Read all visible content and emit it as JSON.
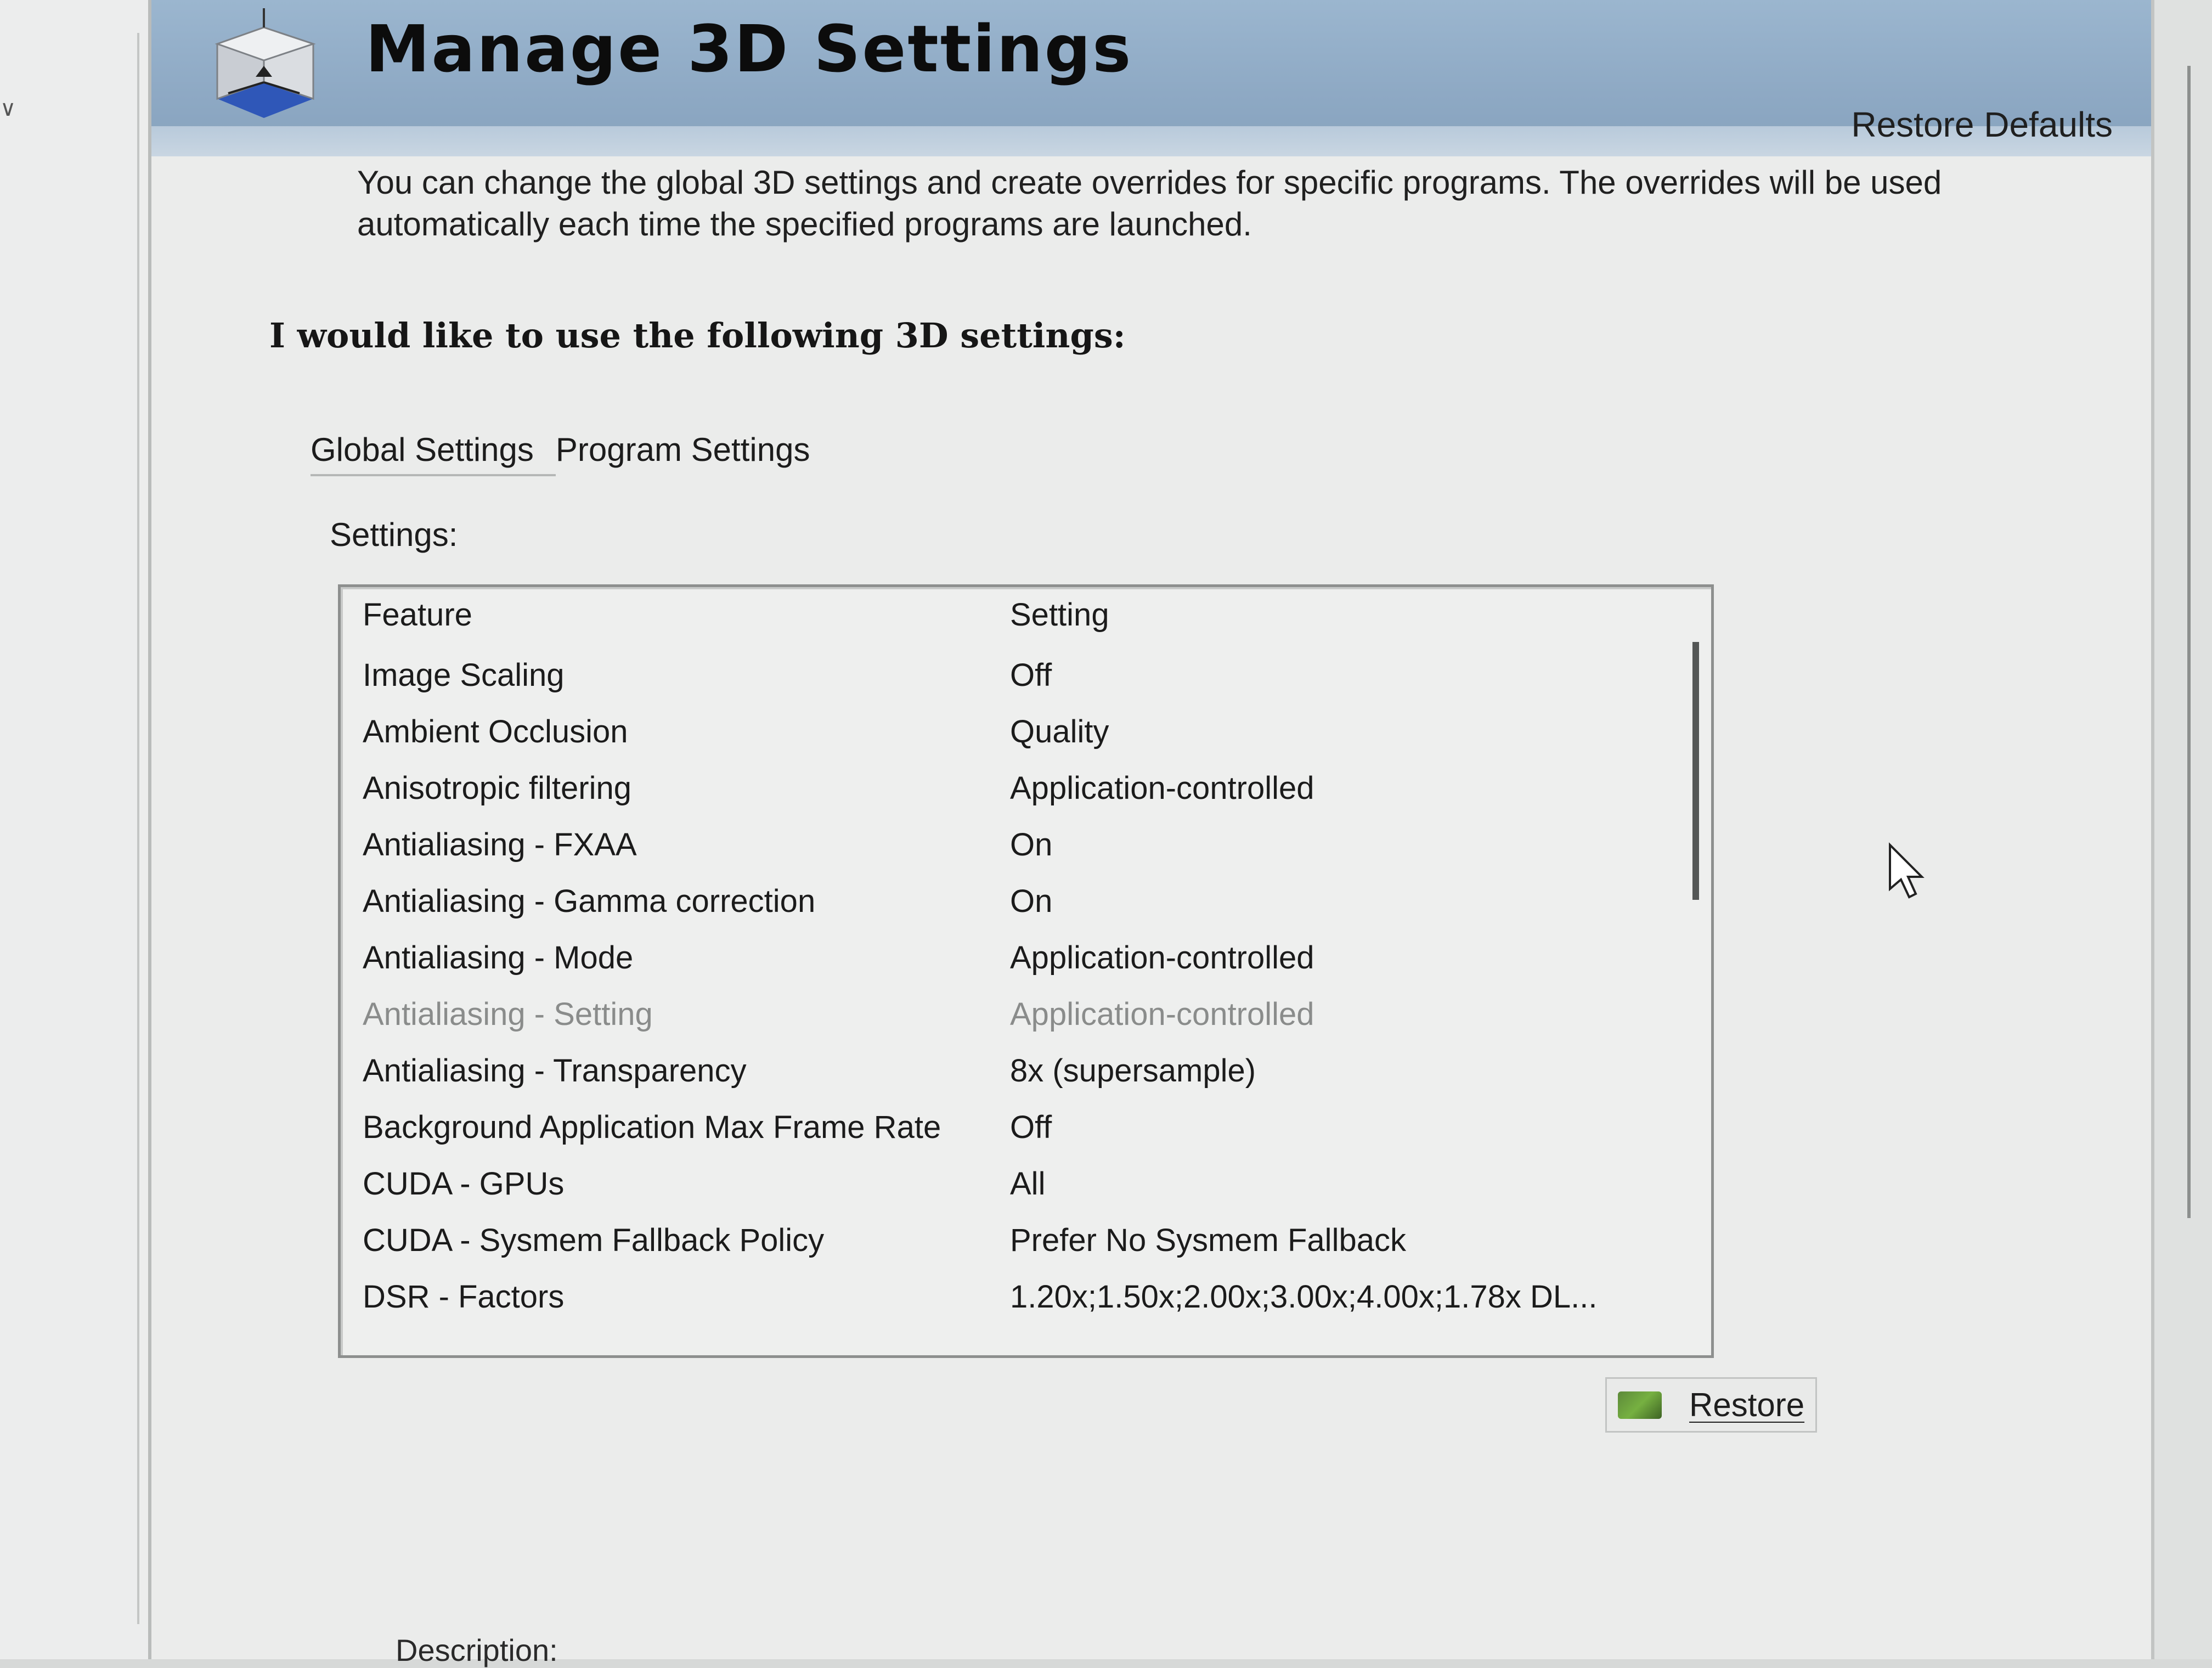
{
  "header": {
    "title": "Manage 3D Settings",
    "restore_defaults": "Restore Defaults"
  },
  "intro_text": "You can change the global 3D settings and create overrides for specific programs. The overrides will be used automatically each time the specified programs are launched.",
  "prompt": "I would like to use the following 3D settings:",
  "tabs": [
    {
      "label": "Global Settings",
      "active": true
    },
    {
      "label": "Program Settings",
      "active": false
    }
  ],
  "settings_label": "Settings:",
  "table": {
    "columns": [
      "Feature",
      "Setting"
    ],
    "rows": [
      {
        "feature": "Image Scaling",
        "setting": "Off"
      },
      {
        "feature": "Ambient Occlusion",
        "setting": "Quality"
      },
      {
        "feature": "Anisotropic filtering",
        "setting": "Application-controlled"
      },
      {
        "feature": "Antialiasing - FXAA",
        "setting": "On"
      },
      {
        "feature": "Antialiasing - Gamma correction",
        "setting": "On"
      },
      {
        "feature": "Antialiasing - Mode",
        "setting": "Application-controlled"
      },
      {
        "feature": "Antialiasing - Setting",
        "setting": "Application-controlled",
        "disabled": true
      },
      {
        "feature": "Antialiasing - Transparency",
        "setting": "8x (supersample)"
      },
      {
        "feature": "Background Application Max Frame Rate",
        "setting": "Off"
      },
      {
        "feature": "CUDA - GPUs",
        "setting": "All"
      },
      {
        "feature": "CUDA - Sysmem Fallback Policy",
        "setting": "Prefer No Sysmem Fallback"
      },
      {
        "feature": "DSR - Factors",
        "setting": "1.20x;1.50x;2.00x;3.00x;4.00x;1.78x DL..."
      }
    ]
  },
  "restore_button": {
    "label": "Restore",
    "icon": "nvidia-icon"
  },
  "description_label": "Description:",
  "icons": {
    "header": "3d-cube-icon",
    "cursor": "mouse-pointer-icon"
  },
  "colors": {
    "header_bg": "#8ea9c4",
    "panel_bg": "#ebeceb",
    "nvidia_green": "#76b041"
  }
}
